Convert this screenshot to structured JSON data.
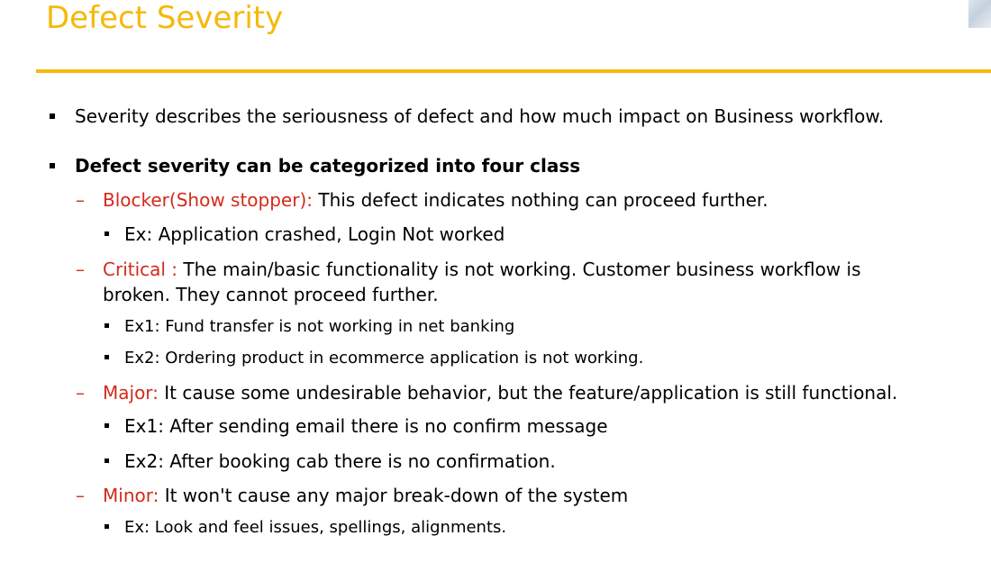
{
  "title": "Defect Severity",
  "colors": {
    "title": "#f5b90a",
    "rule": "#f5b90a",
    "category_label": "#d42a1a",
    "dash": "#e0301e"
  },
  "intro": "Severity describes the seriousness of defect and how much impact on Business workflow.",
  "heading": "Defect severity can be categorized into four class",
  "categories": [
    {
      "label": "Blocker(Show stopper):",
      "description": " This defect indicates nothing can proceed further.",
      "examples": [
        "Ex: Application crashed, Login Not worked"
      ]
    },
    {
      "label": "Critical :",
      "description": " The main/basic functionality is not working. Customer business workflow is",
      "description_cont": "broken. They cannot proceed further.",
      "examples": [
        "Ex1: Fund transfer is not working in net banking",
        "Ex2: Ordering product in ecommerce application is not working."
      ]
    },
    {
      "label": "Major:",
      "description": " It cause some undesirable behavior, but the feature/application is still functional.",
      "examples": [
        "Ex1: After sending email there is no confirm message",
        "Ex2: After booking cab there is no confirmation."
      ]
    },
    {
      "label": "Minor:",
      "description": " It won't cause any major break-down of the system",
      "examples": [
        "Ex: Look and feel issues, spellings, alignments."
      ]
    }
  ]
}
